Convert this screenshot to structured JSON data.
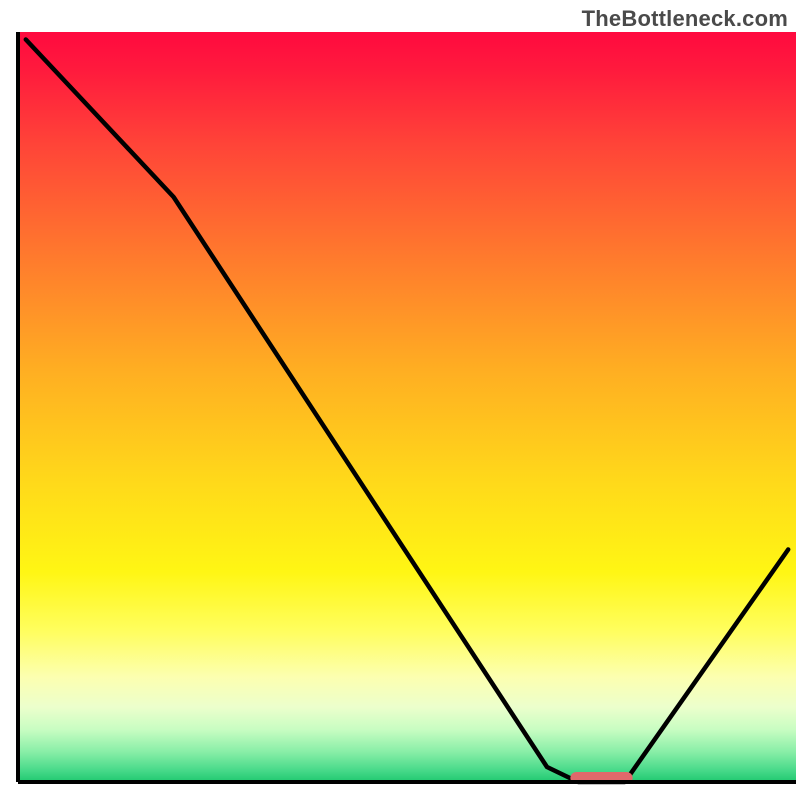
{
  "watermark": "TheBottleneck.com",
  "chart_data": {
    "type": "line",
    "title": "",
    "xlabel": "",
    "ylabel": "",
    "xlim": [
      0,
      100
    ],
    "ylim": [
      0,
      100
    ],
    "curve_points": [
      {
        "x": 1,
        "y": 99
      },
      {
        "x": 20,
        "y": 78
      },
      {
        "x": 68,
        "y": 2
      },
      {
        "x": 72,
        "y": 0
      },
      {
        "x": 78,
        "y": 0
      },
      {
        "x": 99,
        "y": 31
      }
    ],
    "flat_marker": {
      "x_start": 71,
      "x_end": 79,
      "y": 0
    },
    "gradient_stops": [
      {
        "offset": 0.0,
        "color": "#ff0a3f"
      },
      {
        "offset": 0.05,
        "color": "#ff1a3d"
      },
      {
        "offset": 0.15,
        "color": "#ff4438"
      },
      {
        "offset": 0.3,
        "color": "#ff7a2d"
      },
      {
        "offset": 0.45,
        "color": "#ffae22"
      },
      {
        "offset": 0.6,
        "color": "#ffd91a"
      },
      {
        "offset": 0.72,
        "color": "#fff614"
      },
      {
        "offset": 0.8,
        "color": "#fffe60"
      },
      {
        "offset": 0.86,
        "color": "#fcffb0"
      },
      {
        "offset": 0.9,
        "color": "#ecffcc"
      },
      {
        "offset": 0.93,
        "color": "#c8fdc2"
      },
      {
        "offset": 0.96,
        "color": "#88eea7"
      },
      {
        "offset": 0.985,
        "color": "#46d989"
      },
      {
        "offset": 1.0,
        "color": "#1fc86f"
      }
    ],
    "marker_color": "#e0696b",
    "curve_color": "#000000",
    "axis_color": "#000000"
  }
}
